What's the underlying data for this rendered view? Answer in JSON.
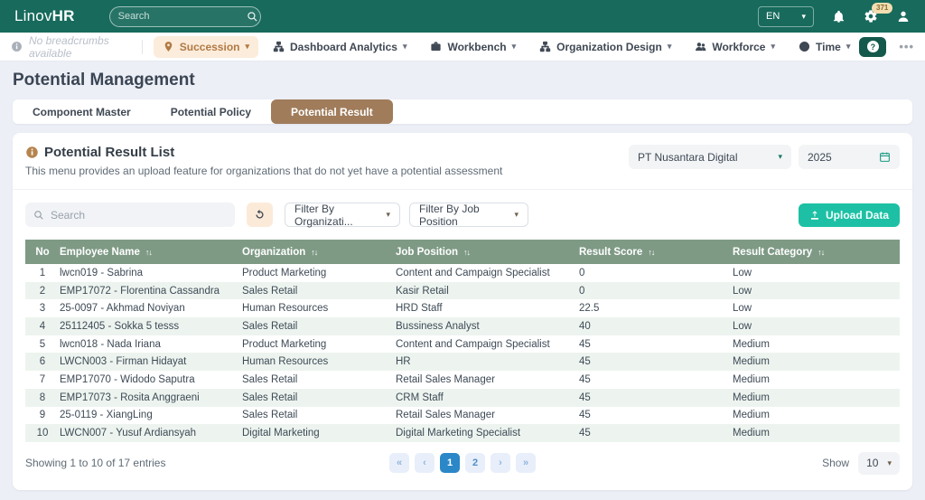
{
  "topbar": {
    "logo_prefix": "Linov",
    "logo_suffix": "HR",
    "search_placeholder": "Search",
    "language": "EN",
    "notifications_badge": "371"
  },
  "nav": {
    "breadcrumb_hint": "No breadcrumbs available",
    "items": [
      {
        "label": "Succession",
        "icon": "pin",
        "active": true
      },
      {
        "label": "Dashboard Analytics",
        "icon": "sitemap",
        "active": false
      },
      {
        "label": "Workbench",
        "icon": "briefcase",
        "active": false
      },
      {
        "label": "Organization Design",
        "icon": "sitemap",
        "active": false
      },
      {
        "label": "Workforce",
        "icon": "users",
        "active": false
      },
      {
        "label": "Time",
        "icon": "clock",
        "active": false
      }
    ]
  },
  "page": {
    "title": "Potential Management"
  },
  "tabs": [
    {
      "label": "Component Master",
      "active": false
    },
    {
      "label": "Potential Policy",
      "active": false
    },
    {
      "label": "Potential Result",
      "active": true
    }
  ],
  "panel": {
    "title": "Potential Result List",
    "description": "This menu provides an upload feature for organizations that do not yet have a potential assessment",
    "company_select": "PT Nusantara Digital",
    "year_select": "2025",
    "search_placeholder": "Search",
    "filter_org": "Filter By Organizati...",
    "filter_job": "Filter By Job Position",
    "upload_button": "Upload Data"
  },
  "table": {
    "columns": [
      {
        "label": "No",
        "sortable": false
      },
      {
        "label": "Employee Name",
        "sortable": true
      },
      {
        "label": "Organization",
        "sortable": true
      },
      {
        "label": "Job Position",
        "sortable": true
      },
      {
        "label": "Result Score",
        "sortable": true
      },
      {
        "label": "Result Category",
        "sortable": true
      }
    ],
    "rows": [
      [
        "1",
        "lwcn019 - Sabrina",
        "Product Marketing",
        "Content and Campaign Specialist",
        "0",
        "Low"
      ],
      [
        "2",
        "EMP17072 - Florentina Cassandra",
        "Sales Retail",
        "Kasir Retail",
        "0",
        "Low"
      ],
      [
        "3",
        "25-0097 - Akhmad Noviyan",
        "Human Resources",
        "HRD Staff",
        "22.5",
        "Low"
      ],
      [
        "4",
        "25112405 - Sokka 5 tesss",
        "Sales Retail",
        "Bussiness Analyst",
        "40",
        "Low"
      ],
      [
        "5",
        "lwcn018 - Nada Iriana",
        "Product Marketing",
        "Content and Campaign Specialist",
        "45",
        "Medium"
      ],
      [
        "6",
        "LWCN003 - Firman Hidayat",
        "Human Resources",
        "HR",
        "45",
        "Medium"
      ],
      [
        "7",
        "EMP17070 - Widodo Saputra",
        "Sales Retail",
        "Retail Sales Manager",
        "45",
        "Medium"
      ],
      [
        "8",
        "EMP17073 - Rosita Anggraeni",
        "Sales Retail",
        "CRM Staff",
        "45",
        "Medium"
      ],
      [
        "9",
        "25-0119 - XiangLing",
        "Sales Retail",
        "Retail Sales Manager",
        "45",
        "Medium"
      ],
      [
        "10",
        "LWCN007 - Yusuf Ardiansyah",
        "Digital Marketing",
        "Digital Marketing Specialist",
        "45",
        "Medium"
      ]
    ]
  },
  "footer": {
    "showing": "Showing 1 to 10 of 17 entries",
    "pagination": [
      "«",
      "‹",
      "1",
      "2",
      "›",
      "»"
    ],
    "active_page": "1",
    "show_label": "Show",
    "page_size": "10"
  },
  "colors": {
    "topbar_teal": "#176a5c",
    "active_tab_brown": "#a07c5b",
    "table_header_green": "#7e9a85",
    "upload_teal": "#1dc0a4",
    "pagination_blue": "#2b87c8",
    "succession_pill_bg": "#fcecdb",
    "succession_text": "#b07a45"
  }
}
